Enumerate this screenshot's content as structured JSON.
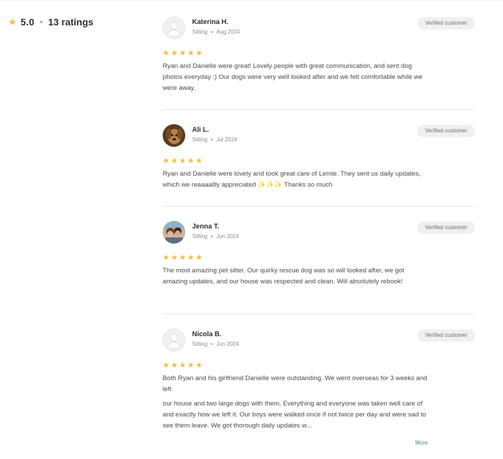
{
  "summary": {
    "rating": "5.0",
    "ratings_count": "13 ratings",
    "star_icon": "star-icon",
    "star_color": "#f2c14e"
  },
  "reviews": [
    {
      "name": "Katerina H.",
      "service": "Sitting",
      "date": "Aug 2024",
      "badge": "Verified customer",
      "stars": 5,
      "avatar": "placeholder-avatar",
      "paragraphs": [
        "Ryan and Danielle were great! Lovely people with great communication, and sent dog photos everyday :) Our dogs were very well looked after and we felt comfortable while we were away."
      ]
    },
    {
      "name": "Ali L.",
      "service": "Sitting",
      "date": "Jul 2024",
      "badge": "Verified customer",
      "stars": 5,
      "avatar": "dog-photo-avatar",
      "paragraphs": [
        "Ryan and Danielle were lovely and took great care of Lemie. They sent us daily updates, which we reaaaallly appreciated ✨✨✨ Thanks so much"
      ]
    },
    {
      "name": "Jenna T.",
      "service": "Sitting",
      "date": "Jun 2024",
      "badge": "Verified customer",
      "stars": 5,
      "avatar": "people-photo-avatar",
      "paragraphs": [
        "The most amazing pet sitter. Our quirky rescue dog was so will looked after, we got amazing updates, and our house was respected and clean. Will absolutely rebook!"
      ]
    },
    {
      "name": "Nicola B.",
      "service": "Sitting",
      "date": "Jun 2024",
      "badge": "Verified customer",
      "stars": 5,
      "avatar": "placeholder-avatar",
      "paragraphs": [
        "Both Ryan and his girlfriend Danielle were outstanding. We went overseas for 3 weeks and left",
        "our house and two large dogs with them. Everything and everyone was taken well care of and exactly how we left it. Our boys were walked once if not twice per day and were sad to see them leave. We got thorough daily updates w..."
      ]
    }
  ],
  "more_label": "More"
}
